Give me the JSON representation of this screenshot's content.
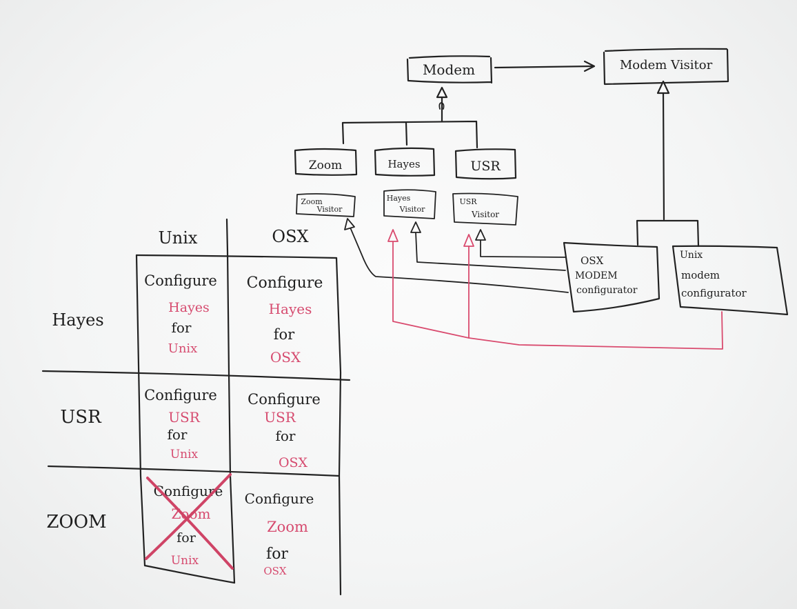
{
  "colors": {
    "ink": "#222222",
    "red_marker": "#d94a6e",
    "board": "#f4f5f5"
  },
  "uml": {
    "modem": "Modem",
    "modem_visitor": "Modem Visitor",
    "zoom": "Zoom",
    "hayes": "Hayes",
    "usr": "USR",
    "zoom_visitor": [
      "Zoom",
      "Visitor"
    ],
    "hayes_visitor": [
      "Hayes",
      "Visitor"
    ],
    "usr_visitor": [
      "USR",
      "Visitor"
    ],
    "osx_configurator": [
      "OSX",
      "MODEM",
      "configurator"
    ],
    "unix_configurator": [
      "Unix",
      "modem",
      "configurator"
    ]
  },
  "grid": {
    "columns": [
      "Unix",
      "OSX"
    ],
    "rows": [
      "Hayes",
      "USR",
      "ZOOM"
    ],
    "cells": [
      [
        {
          "verb": "Configure",
          "modem": "Hayes",
          "prep": "for",
          "os": "Unix"
        },
        {
          "verb": "Configure",
          "modem": "Hayes",
          "prep": "for",
          "os": "OSX"
        }
      ],
      [
        {
          "verb": "Configure",
          "modem": "USR",
          "prep": "for",
          "os": "Unix"
        },
        {
          "verb": "Configure",
          "modem": "USR",
          "prep": "for",
          "os": "OSX"
        }
      ],
      [
        {
          "verb": "Configure",
          "modem": "Zoom",
          "prep": "for",
          "os": "Unix",
          "crossed_out": true
        },
        {
          "verb": "Configure",
          "modem": "Zoom",
          "prep": "for",
          "os": "OSX"
        }
      ]
    ]
  }
}
